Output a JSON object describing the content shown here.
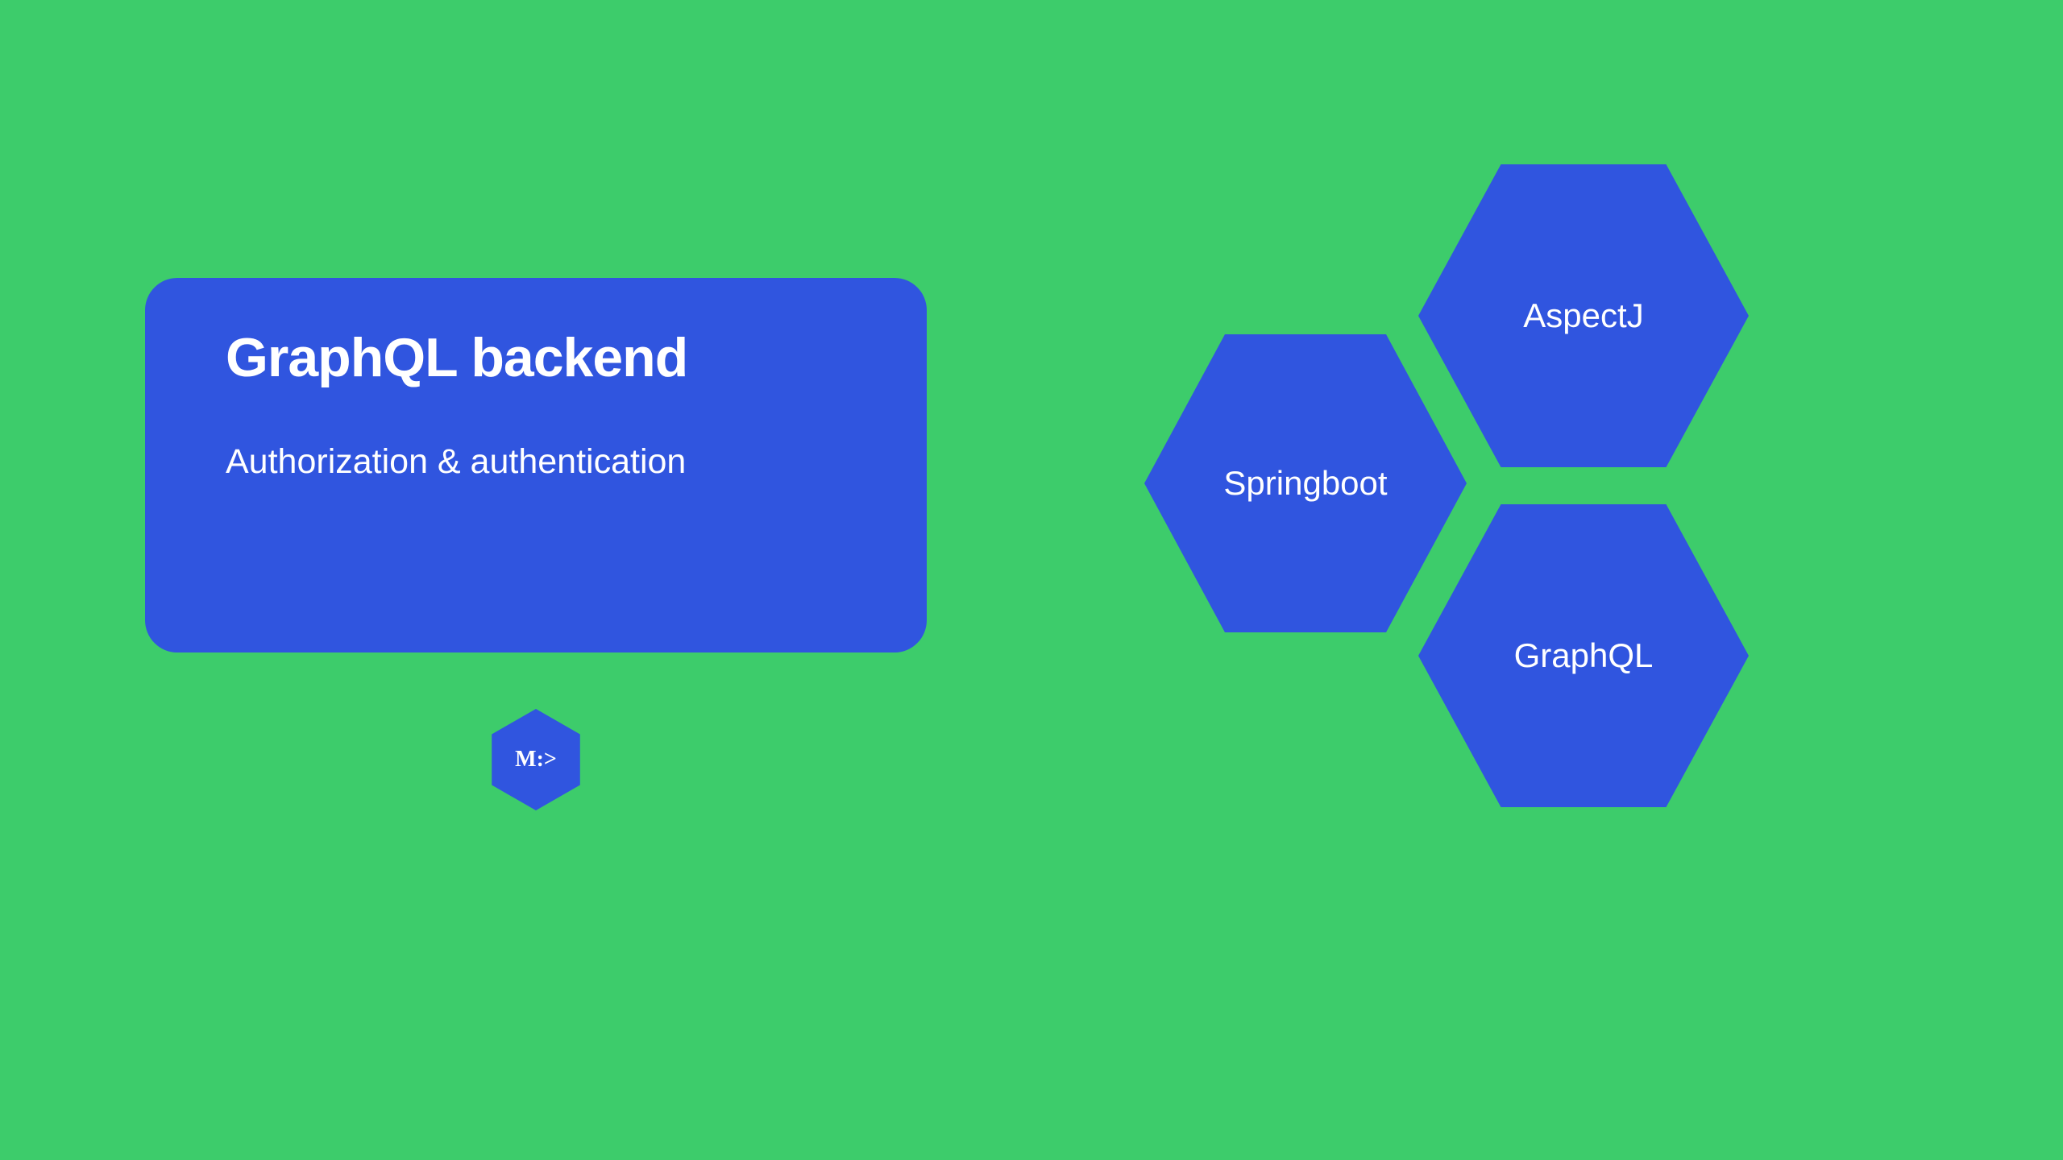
{
  "card": {
    "title": "GraphQL backend",
    "subtitle": "Authorization & authentication"
  },
  "logo": {
    "text": "M:>"
  },
  "hexagons": {
    "springboot": "Springboot",
    "aspectj": "AspectJ",
    "graphql": "GraphQL"
  },
  "colors": {
    "background": "#3DCC6B",
    "shapes": "#3055DF",
    "text": "#ffffff"
  }
}
